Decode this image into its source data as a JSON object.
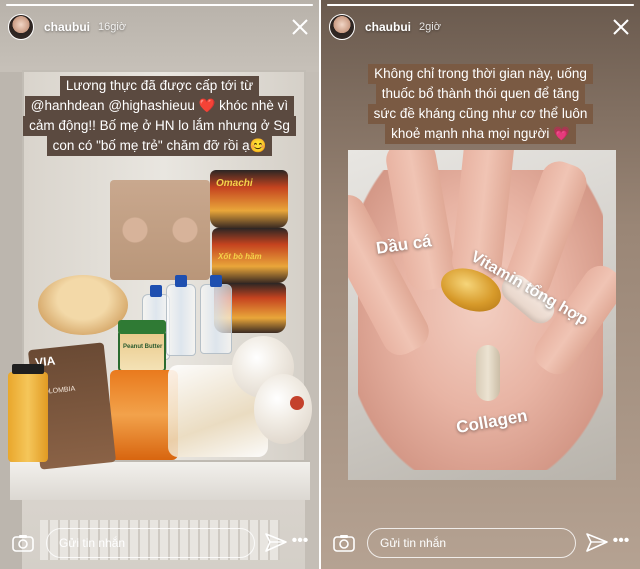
{
  "stories": [
    {
      "username": "chaubui",
      "time": "16giờ",
      "progress": 1.0,
      "caption_lines": [
        "Lương thực đã được cấp  tới từ",
        "@hanhdean @highashieuu ❤️ khóc nhè vì",
        "cảm động!! Bố mẹ ở HN lo lắm nhưng ở Sg",
        "con có \"bố mẹ trẻ\" chăm đỡ rồi ạ😊"
      ],
      "product_texts": {
        "noodle_brand": "Omachi",
        "noodle_brand_2": "Xốt bò hầm",
        "via": "VIA",
        "via_sub": "COLOMBIA",
        "peanut": "Peanut Butter"
      },
      "message_placeholder": "Gửi tin nhắn",
      "more_label": "•••"
    },
    {
      "username": "chaubui",
      "time": "2giờ",
      "progress": 1.0,
      "caption_lines": [
        "Không chỉ trong thời gian này, uống",
        "thuốc bổ thành thói quen để tăng",
        "sức đề kháng cũng như cơ thể luôn",
        "khoẻ mạnh nha mọi người 💗"
      ],
      "pill_labels": {
        "fish_oil": "Dầu cá",
        "vitamin": "Vitamin tổng hợp",
        "collagen": "Collagen"
      },
      "message_placeholder": "Gửi tin nhắn",
      "more_label": "•••"
    }
  ],
  "icons": {
    "close": "close-icon",
    "camera": "camera-icon",
    "send": "send-icon",
    "more": "more-icon"
  }
}
